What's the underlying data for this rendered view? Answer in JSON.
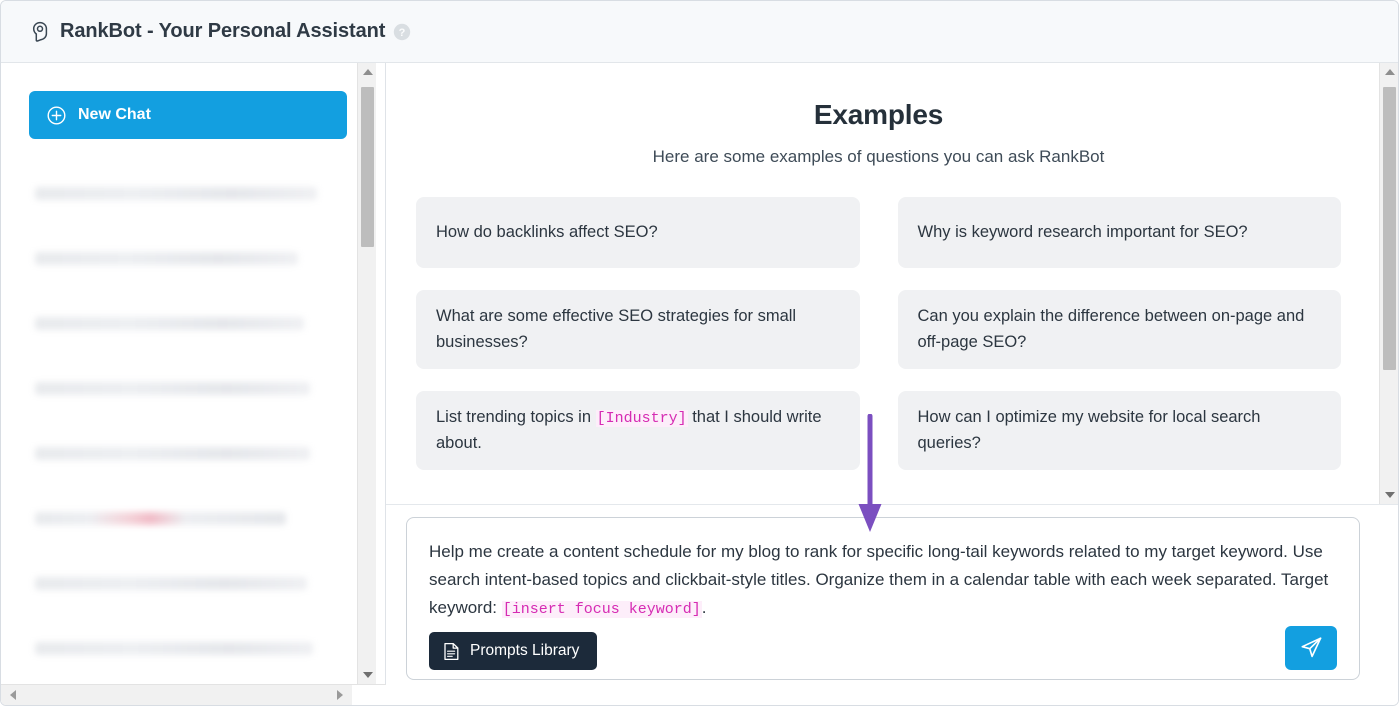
{
  "window": {
    "title": "RankBot - Your Personal Assistant",
    "pin_icon": "location-pin-chat-icon",
    "help_icon": "help-circle-icon"
  },
  "sidebar": {
    "new_chat_label": "New Chat",
    "new_chat_icon": "plus-circle-icon",
    "history_items": [
      {
        "id": 1,
        "redacted": true,
        "width_pct": 92
      },
      {
        "id": 2,
        "redacted": true,
        "width_pct": 86
      },
      {
        "id": 3,
        "redacted": true,
        "width_pct": 88
      },
      {
        "id": 4,
        "redacted": true,
        "width_pct": 90
      },
      {
        "id": 5,
        "redacted": true,
        "width_pct": 90
      },
      {
        "id": 6,
        "redacted": true,
        "width_pct": 82,
        "accent": "pink"
      },
      {
        "id": 7,
        "redacted": true,
        "width_pct": 89
      },
      {
        "id": 8,
        "redacted": true,
        "width_pct": 91
      }
    ],
    "scroll": {
      "up_arrow_icon": "scroll-up-arrow-icon",
      "down_arrow_icon": "scroll-down-arrow-icon",
      "left_arrow_icon": "scroll-left-arrow-icon",
      "right_arrow_icon": "scroll-right-arrow-icon"
    }
  },
  "main": {
    "heading": "Examples",
    "subheading": "Here are some examples of questions you can ask RankBot",
    "example_cards": [
      {
        "text": "How do backlinks affect SEO?"
      },
      {
        "text": "Why is keyword research important for SEO?"
      },
      {
        "text": "What are some effective SEO strategies for small businesses?"
      },
      {
        "text": "Can you explain the difference between on-page and off-page SEO?"
      },
      {
        "text_before": "List trending topics in ",
        "placeholder": "[Industry]",
        "text_after": " that I should write about."
      },
      {
        "text": "How can I optimize my website for local search queries?"
      }
    ],
    "scroll": {
      "up_arrow_icon": "scroll-up-arrow-icon",
      "down_arrow_icon": "scroll-down-arrow-icon"
    }
  },
  "composer": {
    "text_before": "Help me create a content schedule for my blog to rank for specific long-tail keywords related to my target keyword. Use search intent-based topics and clickbait-style titles. Organize them in a calendar table with each week separated. Target keyword: ",
    "placeholder_token": "[insert focus keyword]",
    "text_after": ".",
    "prompts_library_label": "Prompts Library",
    "prompts_library_icon": "document-list-icon",
    "send_icon": "paper-plane-send-icon"
  },
  "annotation": {
    "arrow_icon": "down-arrow-annotation-icon",
    "color": "#7B4FC0"
  },
  "colors": {
    "accent_blue": "#139FE0",
    "dark_button": "#1C2A3A",
    "card_bg": "#F0F1F3",
    "placeholder_pink": "#D62BB3",
    "placeholder_bg": "#FDEEFA",
    "annotation_purple": "#7B4FC0",
    "title_bar_bg": "#F7F9FB",
    "text_primary": "#2C3640"
  }
}
